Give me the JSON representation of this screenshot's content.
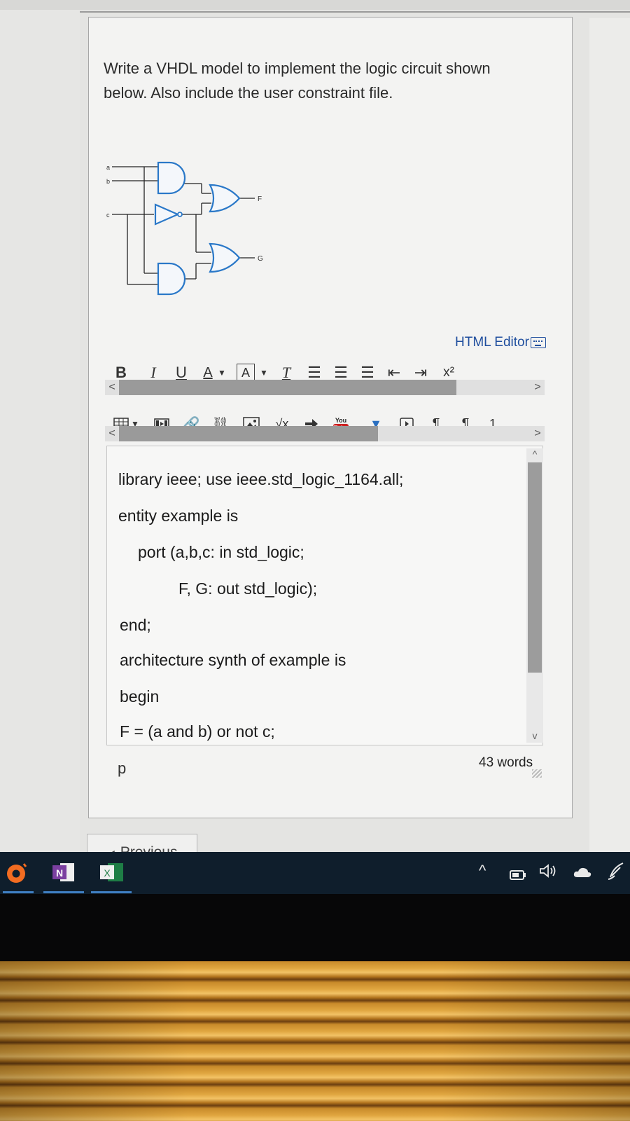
{
  "question": {
    "prompt_line1": "Write a VHDL model to implement the logic circuit shown",
    "prompt_line2": "below. Also include the user constraint file.",
    "circuit": {
      "inputs": [
        "a",
        "b",
        "c"
      ],
      "outputs": [
        "F",
        "G"
      ],
      "gates": [
        "and-gate",
        "not-gate",
        "or-gate",
        "and-gate",
        "or-gate"
      ]
    }
  },
  "editor": {
    "html_editor_label": "HTML Editor",
    "toolbar1": {
      "bold": "B",
      "italic": "I",
      "underline": "U",
      "font_color": "A",
      "highlight": "A",
      "clear_format": "T",
      "superscript": "x²"
    },
    "toolbar2": {
      "youtube_label": "You Tube",
      "overflow_count": "1"
    },
    "code_lines": [
      "library ieee; use ieee.std_logic_1164.all;",
      "entity example is",
      "port (a,b,c: in std_logic;",
      "F, G: out std_logic);",
      "end;",
      "architecture synth of example is",
      "begin",
      "F = (a and b) or not c;"
    ],
    "path": "p",
    "word_count": "43 words"
  },
  "navigation": {
    "previous_label": "Previous"
  },
  "taskbar": {
    "apps": [
      "Origin",
      "OneNote",
      "Excel"
    ],
    "onenote_letter": "N",
    "excel_letter": "X"
  },
  "colors": {
    "link_blue": "#1f4e9e",
    "gate_blue": "#2a78c8",
    "taskbar": "#0f1e2c",
    "origin_orange": "#f26c21",
    "onenote_purple": "#7b3fa0",
    "excel_green": "#1e7d45",
    "youtube_red": "#cc1f1f"
  }
}
